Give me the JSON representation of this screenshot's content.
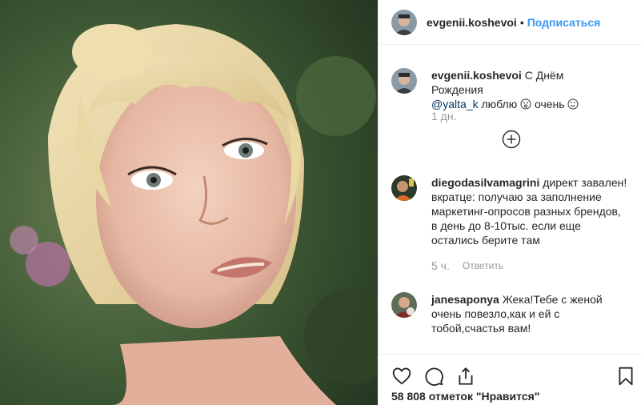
{
  "post": {
    "photo_alt": "",
    "header": {
      "username": "evgenii.koshevoi",
      "separator": "•",
      "follow_label": "Подписаться"
    },
    "caption": {
      "username": "evgenii.koshevoi",
      "text_before": " С Днём Рождения",
      "mention": "@yalta_k",
      "text_after": " люблю",
      "text_end": " очень",
      "time": "1 дн."
    },
    "comments": [
      {
        "username": "diegodasilvamagrini",
        "text": " директ завален! вкратце: получаю за заполнение маркетинг-опросов разных брендов, в день до 8-10тыс. если еще остались берите там",
        "time": "5 ч.",
        "reply_label": "Ответить"
      },
      {
        "username": "janesaponya",
        "text": " Жека!Тебе с женой очень повезло,как и ей с тобой,счастья вам!"
      }
    ],
    "likes": "58 808 отметок \"Нравится\""
  },
  "colors": {
    "link": "#3897f0",
    "mention": "#003569",
    "muted": "#999999"
  }
}
